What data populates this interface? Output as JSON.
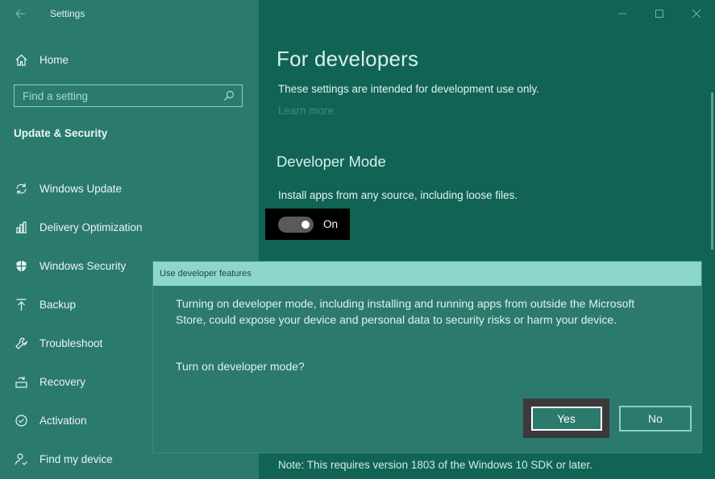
{
  "window": {
    "title": "Settings",
    "controls": [
      "minimize",
      "maximize",
      "close"
    ]
  },
  "sidebar": {
    "home_label": "Home",
    "search_placeholder": "Find a setting",
    "section_title": "Update & Security",
    "items": [
      {
        "label": "Windows Update",
        "icon": "refresh-icon"
      },
      {
        "label": "Delivery Optimization",
        "icon": "delivery-optimization-icon"
      },
      {
        "label": "Windows Security",
        "icon": "shield-icon"
      },
      {
        "label": "Backup",
        "icon": "backup-arrow-icon"
      },
      {
        "label": "Troubleshoot",
        "icon": "wrench-icon"
      },
      {
        "label": "Recovery",
        "icon": "recovery-icon"
      },
      {
        "label": "Activation",
        "icon": "check-circle-icon"
      },
      {
        "label": "Find my device",
        "icon": "person-locate-icon"
      }
    ]
  },
  "main": {
    "page_title": "For developers",
    "intro_text": "These settings are intended for development use only.",
    "learn_more": "Learn more",
    "dev_mode_heading": "Developer Mode",
    "dev_mode_desc": "Install apps from any source, including loose files.",
    "toggle_label": "On",
    "toggle_state": true,
    "note": "Note: This requires version 1803 of the Windows 10 SDK or later."
  },
  "dialog": {
    "title": "Use developer features",
    "body": "Turning on developer mode, including installing and running apps from outside the Microsoft Store, could expose your device and personal data to security risks or harm your device.",
    "question": "Turn on developer mode?",
    "yes_label": "Yes",
    "no_label": "No"
  },
  "colors": {
    "sidebar_bg": "#2b7a6e",
    "main_bg": "#116455",
    "dialog_bg": "#2c7a6d",
    "dialog_titlebar": "#8dd6cb"
  }
}
